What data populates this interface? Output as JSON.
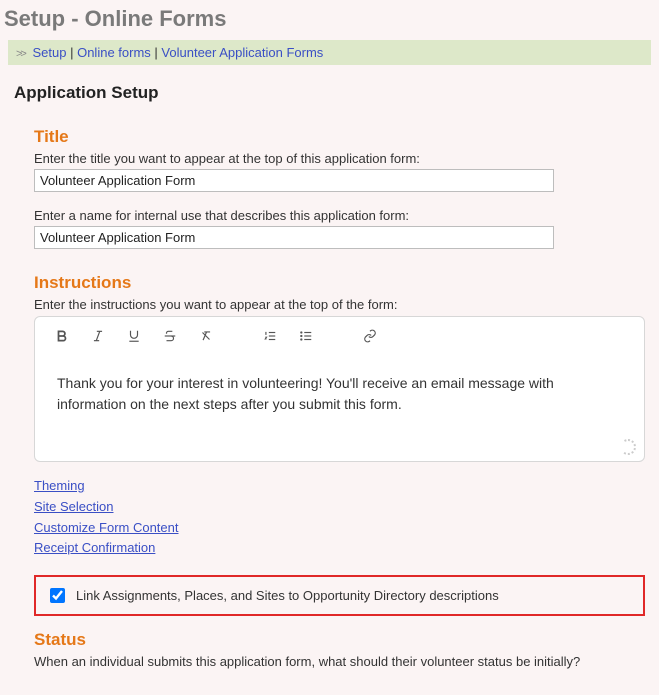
{
  "page_title": "Setup - Online Forms",
  "breadcrumb": {
    "items": [
      "Setup",
      "Online forms",
      "Volunteer Application Forms"
    ]
  },
  "main_heading": "Application Setup",
  "title_section": {
    "heading": "Title",
    "label_display": "Enter the title you want to appear at the top of this application form:",
    "value_display": "Volunteer Application Form",
    "label_internal": "Enter a name for internal use that describes this application form:",
    "value_internal": "Volunteer Application Form"
  },
  "instructions_section": {
    "heading": "Instructions",
    "label": "Enter the instructions you want to appear at the top of the form:",
    "body": "Thank you for your interest in volunteering! You'll receive an email message with information on the next steps after you submit this form."
  },
  "links": {
    "theming": "Theming",
    "site_selection": "Site Selection",
    "customize": "Customize Form Content",
    "receipt": "Receipt Confirmation"
  },
  "link_opportunity": {
    "checked": true,
    "label": "Link Assignments, Places, and Sites to Opportunity Directory descriptions"
  },
  "status_section": {
    "heading": "Status",
    "question": "When an individual submits this application form, what should their volunteer status be initially?"
  }
}
